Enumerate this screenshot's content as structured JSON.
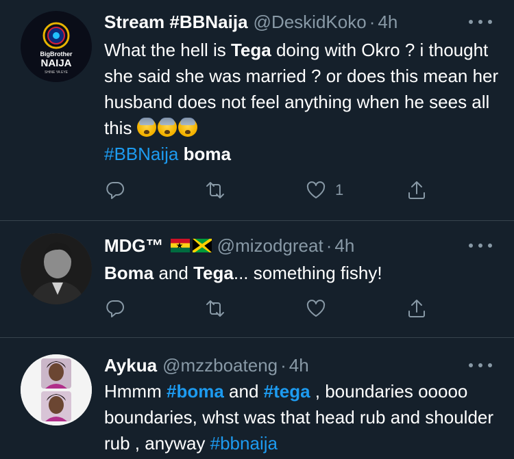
{
  "colors": {
    "background": "#15202b",
    "divider": "#38444d",
    "secondary_text": "#8899a6",
    "link": "#1d9bf0"
  },
  "tweets": [
    {
      "name": "Stream #BBNaija",
      "handle": "@DeskidKoko",
      "time": "4h",
      "avatar": {
        "line1": "BigBrother",
        "line2": "NAIJA",
        "line3": "SHINE YA EYE"
      },
      "text": {
        "p1": "What the hell is ",
        "b1": "Tega",
        "p2": " doing with Okro ?  i thought she said she was married ? or does this mean her husband does not feel anything when he sees  all this ",
        "tag1": "#BBNaija",
        "b2": " boma"
      },
      "emojis": [
        "fearful-face-emoji",
        "fearful-face-emoji",
        "fearful-face-emoji"
      ],
      "actions": {
        "like_count": "1"
      }
    },
    {
      "name": "MDG™",
      "handle": "@mizodgreat",
      "time": "4h",
      "flags": [
        "ghana-flag",
        "jamaica-flag"
      ],
      "text": {
        "b1": "Boma",
        "p1": " and ",
        "b2": "Tega",
        "p2": "... something fishy!"
      }
    },
    {
      "name": "Aykua",
      "handle": "@mzzboateng",
      "time": "4h",
      "text": {
        "p1": "Hmmm ",
        "tag1": "#boma",
        "p2": " and ",
        "tag2": "#tega",
        "p3": " , boundaries ooooo boundaries, whst was that head rub and shoulder rub , anyway ",
        "tag3": "#bbnaija"
      }
    }
  ],
  "separator_dot": "·"
}
